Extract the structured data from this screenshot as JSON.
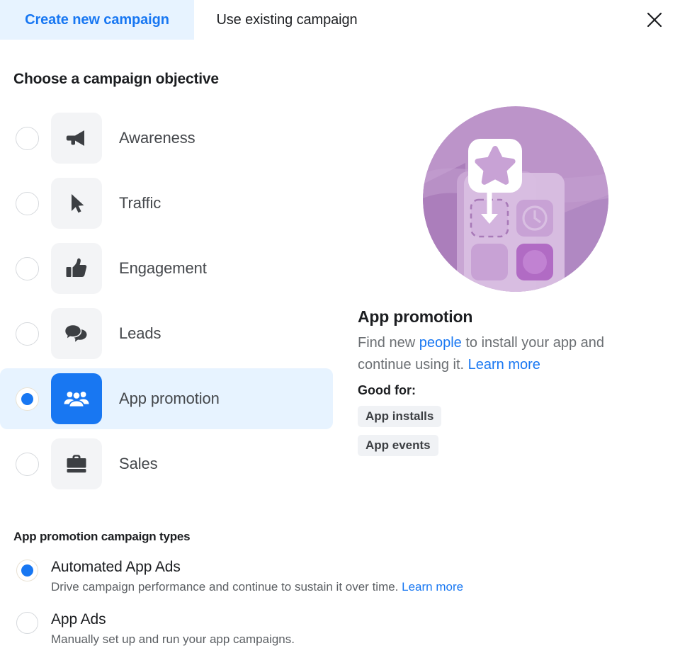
{
  "tabs": [
    {
      "label": "Create new campaign",
      "active": true,
      "name": "tab-create-new-campaign"
    },
    {
      "label": "Use existing campaign",
      "active": false,
      "name": "tab-use-existing-campaign"
    }
  ],
  "close_icon": "close-icon",
  "objective_section": {
    "heading": "Choose a campaign objective",
    "items": [
      {
        "label": "Awareness",
        "icon": "megaphone-icon",
        "selected": false
      },
      {
        "label": "Traffic",
        "icon": "cursor-icon",
        "selected": false
      },
      {
        "label": "Engagement",
        "icon": "thumbs-up-icon",
        "selected": false
      },
      {
        "label": "Leads",
        "icon": "chat-bubbles-icon",
        "selected": false
      },
      {
        "label": "App promotion",
        "icon": "people-icon",
        "selected": true
      },
      {
        "label": "Sales",
        "icon": "briefcase-icon",
        "selected": false
      }
    ]
  },
  "detail": {
    "illustration": "app-install-illustration",
    "title": "App promotion",
    "desc_part1": "Find new ",
    "desc_link1": "people",
    "desc_part2": " to install your app and continue using it. ",
    "desc_link2": "Learn more",
    "good_for_label": "Good for:",
    "pills": [
      "App installs",
      "App events"
    ]
  },
  "types_section": {
    "heading": "App promotion campaign types",
    "items": [
      {
        "title": "Automated App Ads",
        "sub": "Drive campaign performance and continue to sustain it over time. ",
        "link": "Learn more",
        "selected": true
      },
      {
        "title": "App Ads",
        "sub": "Manually set up and run your app campaigns.",
        "link": "",
        "selected": false
      }
    ]
  },
  "colors": {
    "accent": "#1877f2",
    "tab_active_bg": "#e7f3ff",
    "row_selected_bg": "#e7f3ff",
    "tile_bg": "#f3f4f6",
    "pill_bg": "#f0f2f5",
    "text_primary": "#1c1e21",
    "text_secondary": "#6b6f73",
    "illustration_purple": "#b88ec4"
  }
}
